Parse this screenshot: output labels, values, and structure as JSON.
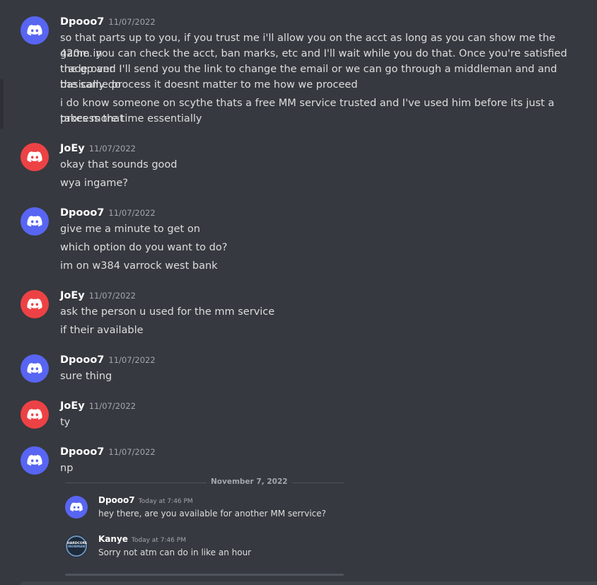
{
  "messages": [
    {
      "author": "Dpooo7",
      "timestamp": "11/07/2022",
      "lines": [
        "so that parts up to you, if you trust me i'll allow you on the acct as long as you can show me the 420m in",
        "game. you can check the acct, ban marks, etc and I'll wait while you do that. Once you're satisfied trade over",
        "the gp and I'll send you the link to change the email or we can go through a middleman and and basically do",
        "the same process it doesnt matter to me how we proceed",
        "i do know someone on scythe thats a free MM service trusted and I've used him before its just a process that",
        "takes more time essentially"
      ]
    },
    {
      "author": "JoEy",
      "timestamp": "11/07/2022",
      "lines": [
        "okay that sounds good",
        "wya ingame?"
      ]
    },
    {
      "author": "Dpooo7",
      "timestamp": "11/07/2022",
      "lines": [
        "give me a minute to get on",
        "which option do you want to do?",
        "im on w384 varrock west bank"
      ]
    },
    {
      "author": "JoEy",
      "timestamp": "11/07/2022",
      "lines": [
        "ask the person u used for the mm service",
        "if their available"
      ]
    },
    {
      "author": "Dpooo7",
      "timestamp": "11/07/2022",
      "lines": [
        "sure thing"
      ]
    },
    {
      "author": "JoEy",
      "timestamp": "11/07/2022",
      "lines": [
        "ty"
      ]
    },
    {
      "author": "Dpooo7",
      "timestamp": "11/07/2022",
      "lines": [
        "np"
      ]
    }
  ],
  "date_divider": "November 7, 2022",
  "embedded": [
    {
      "author": "Dpooo7",
      "timestamp": "Today at 7:46 PM",
      "text": "hey there, are you available for another MM serrvice?"
    },
    {
      "author": "Kanye",
      "timestamp": "Today at 7:46 PM",
      "text": "Sorry not atm can do in like an hour",
      "avatar_text": [
        "HARDCORE",
        "IRONMAN"
      ]
    }
  ],
  "colors": {
    "background": "#36393f",
    "blurple": "#5865f2",
    "red": "#ed4245",
    "text": "#dcddde",
    "muted": "#a3a6aa"
  },
  "icons": {
    "discord_avatar": "discord-logo-icon"
  }
}
